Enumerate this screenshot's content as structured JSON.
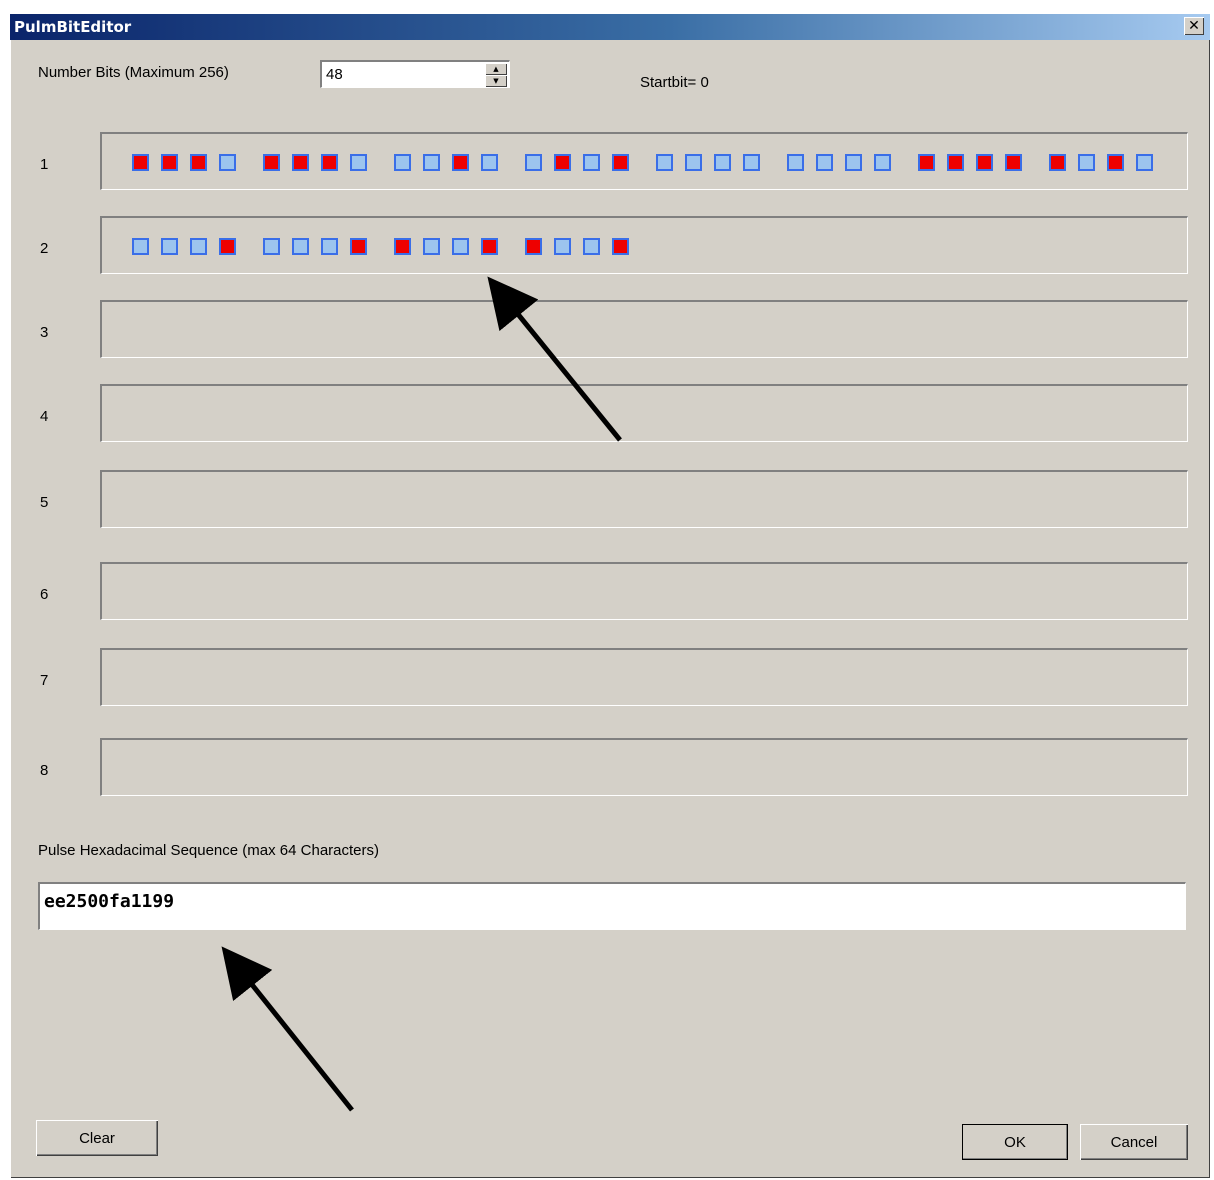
{
  "window": {
    "title": "PulmBitEditor",
    "close_symbol": "✕"
  },
  "header": {
    "number_bits_label": "Number Bits (Maximum 256)",
    "number_bits_value": "48",
    "startbit_text": "Startbit= 0",
    "spin_up": "▲",
    "spin_down": "▼"
  },
  "rows": [
    {
      "label": "1",
      "bits": [
        1,
        1,
        1,
        0,
        1,
        1,
        1,
        0,
        0,
        0,
        1,
        0,
        0,
        1,
        0,
        1,
        0,
        0,
        0,
        0,
        0,
        0,
        0,
        0,
        1,
        1,
        1,
        1,
        1,
        0,
        1,
        0
      ]
    },
    {
      "label": "2",
      "bits": [
        0,
        0,
        0,
        1,
        0,
        0,
        0,
        1,
        1,
        0,
        0,
        1,
        1,
        0,
        0,
        1
      ]
    },
    {
      "label": "3",
      "bits": []
    },
    {
      "label": "4",
      "bits": []
    },
    {
      "label": "5",
      "bits": []
    },
    {
      "label": "6",
      "bits": []
    },
    {
      "label": "7",
      "bits": []
    },
    {
      "label": "8",
      "bits": []
    }
  ],
  "hex": {
    "label": "Pulse Hexadacimal Sequence (max 64 Characters)",
    "value": "ee2500fa1199"
  },
  "buttons": {
    "clear": "Clear",
    "ok": "OK",
    "cancel": "Cancel"
  },
  "colors": {
    "bit_on": "#ee0000",
    "bit_off": "#9cc4ee",
    "bit_border": "#3a6ee8"
  }
}
